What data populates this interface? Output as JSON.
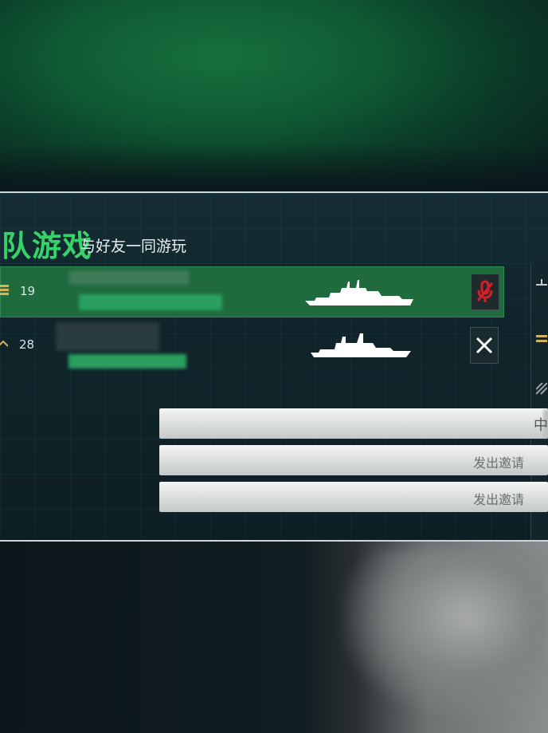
{
  "header": {
    "title": "队游戏",
    "subtitle": "与好友一同游玩"
  },
  "party": [
    {
      "level": "19",
      "selected": true,
      "action_icon": "mic-muted-icon"
    },
    {
      "level": "28",
      "selected": false,
      "action_icon": "close-icon"
    }
  ],
  "invite_list": [
    {
      "label": "中",
      "status": "obscured"
    },
    {
      "label": "发出邀请"
    },
    {
      "label": "发出邀请"
    }
  ],
  "colors": {
    "accent_green": "#37d36a",
    "selected_row": "#1f6b3d",
    "mic_muted_red": "#d3202a"
  }
}
